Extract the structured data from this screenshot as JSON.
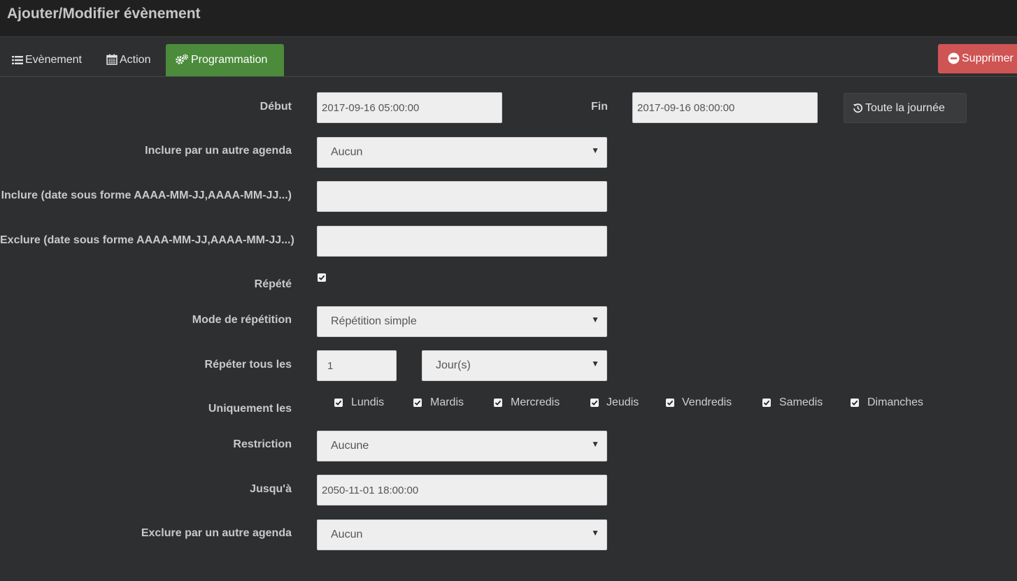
{
  "window": {
    "title": "Ajouter/Modifier évènement"
  },
  "tabs": [
    {
      "label": "Evènement",
      "icon": "list-icon",
      "active": false
    },
    {
      "label": "Action",
      "icon": "calendar-icon",
      "active": false
    },
    {
      "label": "Programmation",
      "icon": "cogs-icon",
      "active": true
    }
  ],
  "toolbar": {
    "delete_label": "Supprimer"
  },
  "colors": {
    "active_tab": "#4b8b3b",
    "delete": "#cf5454",
    "background": "#2e2f31"
  },
  "form": {
    "start": {
      "label": "Début",
      "value": "2017-09-16 05:00:00"
    },
    "end": {
      "label": "Fin",
      "value": "2017-09-16 08:00:00"
    },
    "all_day_button": "Toute la journée",
    "include_agenda": {
      "label": "Inclure par un autre agenda",
      "value": "Aucun"
    },
    "include_dates": {
      "label": "Inclure (date sous forme AAAA-MM-JJ,AAAA-MM-JJ...)",
      "value": ""
    },
    "exclude_dates": {
      "label": "Exclure (date sous forme AAAA-MM-JJ,AAAA-MM-JJ...)",
      "value": ""
    },
    "repeat": {
      "label": "Répété",
      "checked": true
    },
    "repeat_mode": {
      "label": "Mode de répétition",
      "value": "Répétition simple"
    },
    "repeat_every": {
      "label": "Répéter tous les",
      "value": "1",
      "unit": "Jour(s)"
    },
    "only_days": {
      "label": "Uniquement les",
      "days": [
        {
          "label": "Lundis",
          "checked": true
        },
        {
          "label": "Mardis",
          "checked": true
        },
        {
          "label": "Mercredis",
          "checked": true
        },
        {
          "label": "Jeudis",
          "checked": true
        },
        {
          "label": "Vendredis",
          "checked": true
        },
        {
          "label": "Samedis",
          "checked": true
        },
        {
          "label": "Dimanches",
          "checked": true
        }
      ]
    },
    "restriction": {
      "label": "Restriction",
      "value": "Aucune"
    },
    "until": {
      "label": "Jusqu'à",
      "value": "2050-11-01 18:00:00"
    },
    "exclude_agenda": {
      "label": "Exclure par un autre agenda",
      "value": "Aucun"
    }
  }
}
